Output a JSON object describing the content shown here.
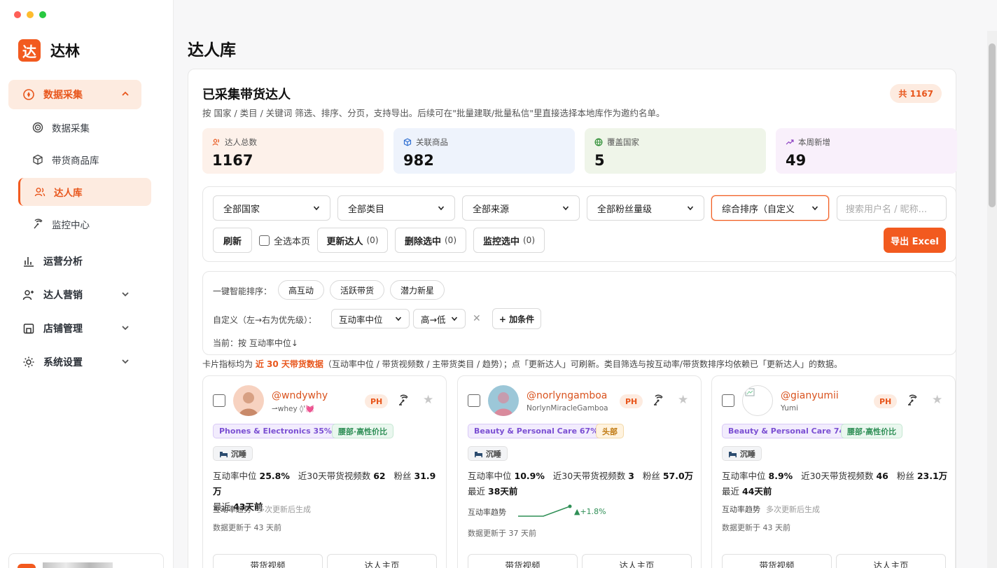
{
  "app": {
    "logo_char": "达",
    "name": "达林"
  },
  "window": {
    "dot_colors": [
      "#fe5f57",
      "#febc2e",
      "#28c840"
    ]
  },
  "sidebar": {
    "groups": [
      {
        "label": "数据采集",
        "icon": "data-collect-icon",
        "expanded": true
      },
      {
        "label": "运营分析",
        "icon": "bar-chart-icon"
      },
      {
        "label": "达人营销",
        "icon": "user-plus-icon"
      },
      {
        "label": "店铺管理",
        "icon": "store-icon"
      },
      {
        "label": "系统设置",
        "icon": "gear-icon"
      }
    ],
    "sub_items": [
      {
        "label": "数据采集",
        "icon": "target-icon"
      },
      {
        "label": "带货商品库",
        "icon": "cube-icon"
      },
      {
        "label": "达人库",
        "icon": "users-icon",
        "active": true
      },
      {
        "label": "监控中心",
        "icon": "antenna-icon"
      }
    ]
  },
  "page": {
    "title": "达人库",
    "section_title": "已采集带货达人",
    "section_desc": "按 国家 / 类目 / 关键词 筛选、排序、分页，支持导出。后续可在\"批量建联/批量私信\"里直接选择本地库作为邀约名单。",
    "total_badge": "共 1167"
  },
  "stats": [
    {
      "label": "达人总数",
      "value": "1167",
      "icon": "users-icon",
      "bg": "#fdf1ea",
      "icon_color": "#e8561c"
    },
    {
      "label": "关联商品",
      "value": "982",
      "icon": "cube-icon",
      "bg": "#eef3fc",
      "icon_color": "#2f6fd1"
    },
    {
      "label": "覆盖国家",
      "value": "5",
      "icon": "globe-icon",
      "bg": "#eff5e9",
      "icon_color": "#2f8f36"
    },
    {
      "label": "本周新增",
      "value": "49",
      "icon": "trend-up-icon",
      "bg": "#f9f0fb",
      "icon_color": "#8b3fc1"
    }
  ],
  "filters": {
    "selects": [
      "全部国家",
      "全部类目",
      "全部来源",
      "全部粉丝量级",
      "综合排序（自定义"
    ],
    "search_placeholder": "搜索用户名 / 昵称...",
    "refresh": "刷新",
    "select_page": "全选本页",
    "update": "更新达人",
    "update_count": "(0)",
    "delete": "删除选中",
    "delete_count": "(0)",
    "monitor": "监控选中",
    "monitor_count": "(0)",
    "export": "导出 Excel"
  },
  "sorting": {
    "quick_label": "一键智能排序：",
    "quick": [
      "高互动",
      "活跃带货",
      "潜力新星"
    ],
    "custom_label": "自定义（左→右为优先级）：",
    "field": "互动率中位",
    "order": "高→低",
    "add": "+ 加条件",
    "current": "当前：按 互动率中位↓"
  },
  "note": {
    "pre": "卡片指标均为",
    "highlight": "近 30 天带货数据",
    "post": "（互动率中位 / 带货视频数 / 主带货类目 / 趋势）；点「更新达人」可刷新。类目筛选与按互动率/带货数排序均依赖已「更新达人」的数据。"
  },
  "card_labels": {
    "engage": "互动率中位",
    "videos": "近30天带货视频数",
    "fans": "粉丝",
    "recent": "最近",
    "trend": "互动率趋势",
    "btn_video": "带货视频",
    "btn_home": "达人主页"
  },
  "cards": [
    {
      "handle": "@wndywhy",
      "nickname": "⇀whey ◊'💓",
      "country": "PH",
      "category": "Phones & Electronics 35%",
      "tag2": "腰部·高性价比",
      "tag2_style": "grn",
      "activity": "沉睡",
      "engage": "25.8%",
      "videos": "62",
      "fans": "31.9万",
      "recent": "43天前",
      "trend_text": "多次更新后生成",
      "updated": "数据更新于 43 天前",
      "avatar_colors": [
        "#f7d2c0",
        "#c98a6a"
      ]
    },
    {
      "handle": "@norlyngamboa",
      "nickname": "NorlynMiracleGamboa",
      "country": "PH",
      "category": "Beauty & Personal Care 67%",
      "tag2": "头部",
      "tag2_style": "org",
      "activity": "沉睡",
      "engage": "10.9%",
      "videos": "3",
      "fans": "57.0万",
      "recent": "38天前",
      "trend_delta": "▲+1.8%",
      "trend_points": [
        0,
        0,
        2.2
      ],
      "updated": "数据更新于 37 天前",
      "avatar_colors": [
        "#9cc7d8",
        "#d98a9c"
      ]
    },
    {
      "handle": "@gianyumii",
      "nickname": "Yumi",
      "country": "PH",
      "category": "Beauty & Personal Care 74%",
      "tag2": "腰部·高性价比",
      "tag2_style": "grn",
      "activity": "沉睡",
      "engage": "8.9%",
      "videos": "46",
      "fans": "23.1万",
      "recent": "44天前",
      "trend_text": "多次更新后生成",
      "updated": "数据更新于 43 天前",
      "avatar_colors": [
        "#f3f3f3",
        "#dcdcdc"
      ]
    }
  ]
}
